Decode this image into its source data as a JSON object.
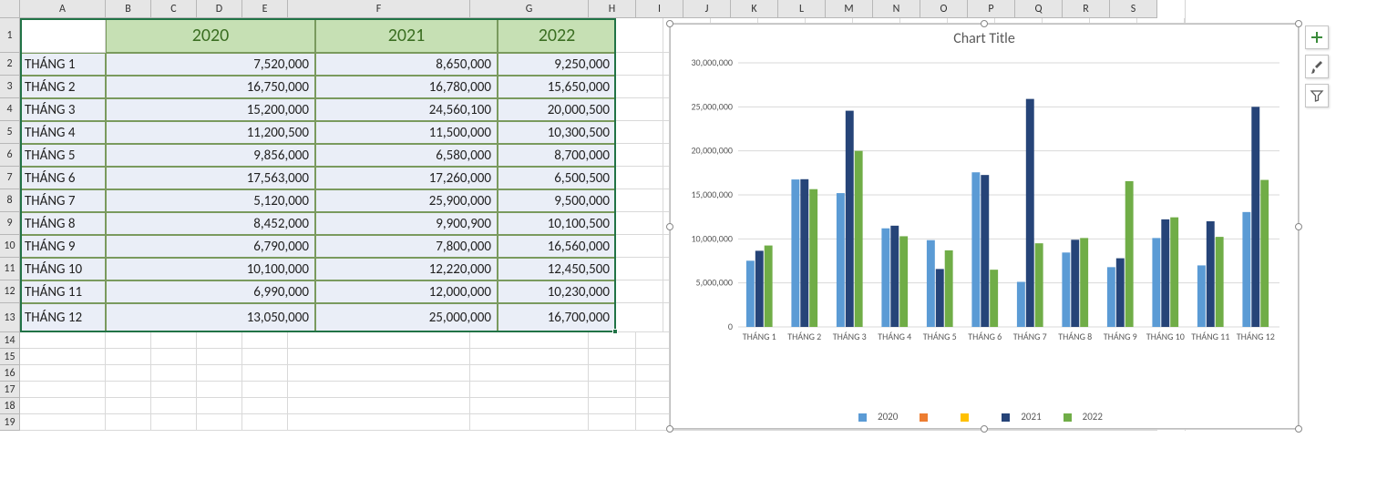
{
  "columns": [
    "A",
    "B",
    "C",
    "D",
    "E",
    "F",
    "G",
    "H",
    "I",
    "J",
    "K",
    "L",
    "M",
    "N",
    "O",
    "P",
    "Q",
    "R",
    "S"
  ],
  "row_numbers": [
    1,
    2,
    3,
    4,
    5,
    6,
    7,
    8,
    9,
    10,
    11,
    12,
    13,
    14,
    15,
    16,
    17,
    18,
    19
  ],
  "headers": {
    "blank": "",
    "y2020": "2020",
    "y2021": "2021",
    "y2022": "2022"
  },
  "months": [
    "THÁNG 1",
    "THÁNG 2",
    "THÁNG 3",
    "THÁNG 4",
    "THÁNG 5",
    "THÁNG 6",
    "THÁNG 7",
    "THÁNG 8",
    "THÁNG 9",
    "THÁNG 10",
    "THÁNG 11",
    "THÁNG 12"
  ],
  "values": {
    "y2020": [
      "7,520,000",
      "16,750,000",
      "15,200,000",
      "11,200,500",
      "9,856,000",
      "17,563,000",
      "5,120,000",
      "8,452,000",
      "6,790,000",
      "10,100,000",
      "6,990,000",
      "13,050,000"
    ],
    "y2021": [
      "8,650,000",
      "16,780,000",
      "24,560,100",
      "11,500,000",
      "6,580,000",
      "17,260,000",
      "25,900,000",
      "9,900,900",
      "7,800,000",
      "12,220,000",
      "12,000,000",
      "25,000,000"
    ],
    "y2022": [
      "9,250,000",
      "15,650,000",
      "20,000,500",
      "10,300,500",
      "8,700,000",
      "6,500,500",
      "9,500,000",
      "10,100,500",
      "16,560,000",
      "12,450,500",
      "10,230,000",
      "16,700,000"
    ]
  },
  "chart": {
    "title": "Chart Title",
    "legend_labels": [
      "2020",
      "",
      "",
      "2021",
      "2022"
    ],
    "legend_colors": [
      "#5b9bd5",
      "#ed7d31",
      "#ffc000",
      "#264478",
      "#70ad47"
    ]
  },
  "chart_data": {
    "type": "bar",
    "title": "Chart Title",
    "xlabel": "",
    "ylabel": "",
    "ylim": [
      0,
      30000000
    ],
    "yticks": [
      0,
      5000000,
      10000000,
      15000000,
      20000000,
      25000000,
      30000000
    ],
    "ytick_labels": [
      "0",
      "5,000,000",
      "10,000,000",
      "15,000,000",
      "20,000,000",
      "25,000,000",
      "30,000,000"
    ],
    "categories": [
      "THÁNG 1",
      "THÁNG 2",
      "THÁNG 3",
      "THÁNG 4",
      "THÁNG 5",
      "THÁNG 6",
      "THÁNG 7",
      "THÁNG 8",
      "THÁNG 9",
      "THÁNG 10",
      "THÁNG 11",
      "THÁNG 12"
    ],
    "series": [
      {
        "name": "2020",
        "color": "#5b9bd5",
        "values": [
          7520000,
          16750000,
          15200000,
          11200500,
          9856000,
          17563000,
          5120000,
          8452000,
          6790000,
          10100000,
          6990000,
          13050000
        ]
      },
      {
        "name": "2021",
        "color": "#264478",
        "values": [
          8650000,
          16780000,
          24560100,
          11500000,
          6580000,
          17260000,
          25900000,
          9900900,
          7800000,
          12220000,
          12000000,
          25000000
        ]
      },
      {
        "name": "2022",
        "color": "#70ad47",
        "values": [
          9250000,
          15650000,
          20000500,
          10300500,
          8700000,
          6500500,
          9500000,
          10100500,
          16560000,
          12450500,
          10230000,
          16700000
        ]
      }
    ]
  }
}
